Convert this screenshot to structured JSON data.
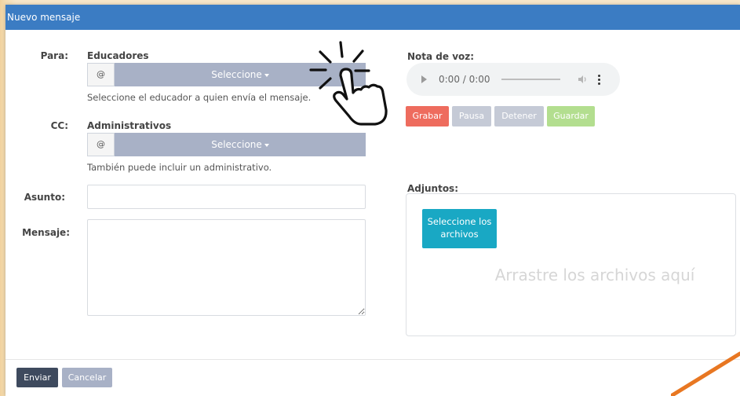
{
  "modal": {
    "title": "Nuevo mensaje"
  },
  "to": {
    "label": "Para:",
    "group_title": "Educadores",
    "addon": "@",
    "select_label": "Seleccione",
    "help": "Seleccione el educador a quien envía el mensaje."
  },
  "cc": {
    "label": "CC:",
    "group_title": "Administrativos",
    "addon": "@",
    "select_label": "Seleccione",
    "help": "También puede incluir un administrativo."
  },
  "subject": {
    "label": "Asunto:",
    "value": ""
  },
  "message": {
    "label": "Mensaje:",
    "value": ""
  },
  "voice_note": {
    "label": "Nota de voz:",
    "time": "0:00 / 0:00",
    "buttons": {
      "record": "Grabar",
      "pause": "Pausa",
      "stop": "Detener",
      "save": "Guardar"
    },
    "colors": {
      "record": "#ee6c5e",
      "pause": "#c5cad6",
      "stop": "#c5cad6",
      "save": "#b3de8f"
    }
  },
  "attachments": {
    "label": "Adjuntos:",
    "select_files": "Seleccione los archivos",
    "drop_text": "Arrastre los archivos aquí"
  },
  "footer": {
    "send": "Enviar",
    "cancel": "Cancelar"
  },
  "colors": {
    "header": "#3b7cc3",
    "select": "#a8b1c6",
    "send": "#3e4a5e",
    "cancel": "#a8b1c6",
    "files": "#19a8c4"
  }
}
